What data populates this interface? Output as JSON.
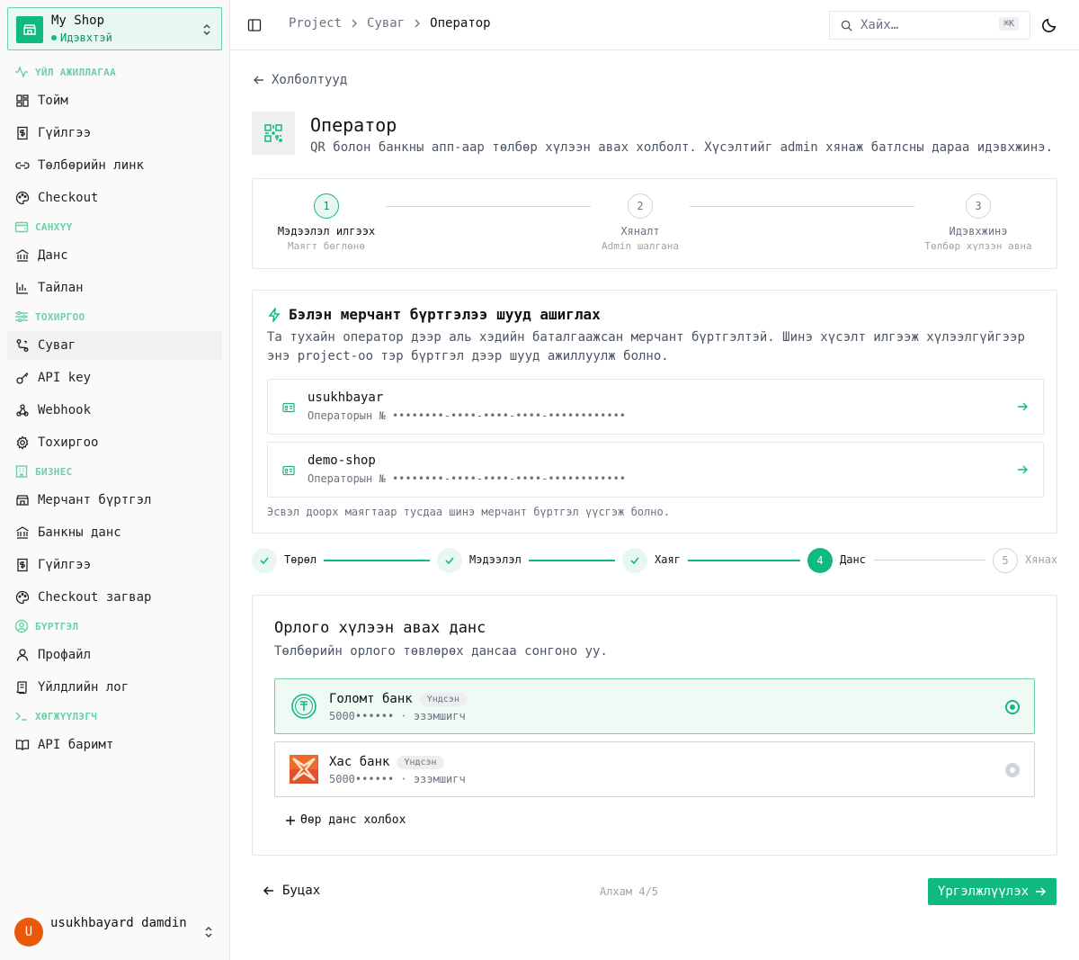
{
  "shop": {
    "name": "My Shop",
    "status": "Идэвхтэй"
  },
  "sidebar": {
    "sections": [
      {
        "label": "ҮЙЛ АЖИЛЛАГАА",
        "icon": "activity-icon"
      },
      {
        "label": "САНХҮҮ",
        "icon": "wallet-icon"
      },
      {
        "label": "ТОХИРГОО",
        "icon": "sliders-icon"
      },
      {
        "label": "БИЗНЕС",
        "icon": "building-icon"
      },
      {
        "label": "БҮРТГЭЛ",
        "icon": "user-circle-icon"
      },
      {
        "label": "ХӨГЖҮҮЛЭГЧ",
        "icon": "terminal-icon"
      }
    ],
    "items": [
      {
        "label": "Тойм",
        "icon": "dashboard-icon"
      },
      {
        "label": "Гүйлгээ",
        "icon": "receipt-icon"
      },
      {
        "label": "Төлбөрийн линк",
        "icon": "link-icon"
      },
      {
        "label": "Checkout",
        "icon": "palette-icon"
      },
      {
        "label": "Данс",
        "icon": "bank-icon"
      },
      {
        "label": "Тайлан",
        "icon": "bar-chart-icon"
      },
      {
        "label": "Суваг",
        "icon": "route-icon",
        "active": true
      },
      {
        "label": "API key",
        "icon": "key-icon"
      },
      {
        "label": "Webhook",
        "icon": "webhook-icon"
      },
      {
        "label": "Тохиргоо",
        "icon": "gear-icon"
      },
      {
        "label": "Мерчант бүртгэл",
        "icon": "store-icon"
      },
      {
        "label": "Банкны данс",
        "icon": "bank-icon"
      },
      {
        "label": "Гүйлгээ",
        "icon": "receipt-icon"
      },
      {
        "label": "Checkout загвар",
        "icon": "palette-icon"
      },
      {
        "label": "Профайл",
        "icon": "user-icon"
      },
      {
        "label": "Үйлдлийн лог",
        "icon": "log-icon"
      },
      {
        "label": "API баримт",
        "icon": "book-icon"
      }
    ]
  },
  "user": {
    "initial": "U",
    "name": "usukhbayard damdin"
  },
  "header": {
    "breadcrumb": [
      "Project",
      "Суваг",
      "Оператор"
    ],
    "search_placeholder": "Хайх…",
    "search_shortcut": "⌘K"
  },
  "page": {
    "back_label": "Холболтууд",
    "title": "Оператор",
    "description": "QR болон банкны апп-аар төлбөр хүлээн авах холболт. Хүсэлтийг admin хянаж батлсны дараа идэвхжинэ."
  },
  "process_steps": [
    {
      "num": "1",
      "label": "Мэдээлэл илгээх",
      "sub": "Маягт бөглөнө"
    },
    {
      "num": "2",
      "label": "Хяналт",
      "sub": "Admin шалгана"
    },
    {
      "num": "3",
      "label": "Идэвхжинэ",
      "sub": "Төлбөр хүлээн авна"
    }
  ],
  "existing": {
    "title": "Бэлэн мерчант бүртгэлээ шууд ашиглах",
    "description": "Та тухайн оператор дээр аль хэдийн баталгаажсан мерчант бүртгэлтэй. Шинэ хүсэлт илгээж хүлээлгүйгээр энэ project-оо тэр бүртгэл дээр шууд ажиллуулж болно.",
    "merchants": [
      {
        "name": "usukhbayar",
        "id_label": "Операторын №",
        "id": "••••••••-••••-••••-••••-••••••••••••"
      },
      {
        "name": "demo-shop",
        "id_label": "Операторын №",
        "id": "••••••••-••••-••••-••••-••••••••••••"
      }
    ],
    "footer": "Эсвэл доорх маягтаар тусдаа шинэ мерчант бүртгэл үүсгэж болно."
  },
  "wizard": {
    "steps": [
      {
        "label": "Төрөл",
        "state": "done"
      },
      {
        "label": "Мэдээлэл",
        "state": "done"
      },
      {
        "label": "Хаяг",
        "state": "done"
      },
      {
        "label": "Данс",
        "state": "current",
        "num": "4"
      },
      {
        "label": "Хянах",
        "state": "todo",
        "num": "5"
      }
    ]
  },
  "account": {
    "title": "Орлого хүлээн авах данс",
    "description": "Төлбөрийн орлого төвлөрөх дансаа сонгоно уу.",
    "banks": [
      {
        "name": "Голомт банк",
        "badge": "Үндсэн",
        "number": "5000•••••• · эзэмшигч",
        "selected": true
      },
      {
        "name": "Хас банк",
        "badge": "Үндсэн",
        "number": "5000•••••• · эзэмшигч",
        "selected": false
      }
    ],
    "add_label": "Өөр данс холбох"
  },
  "footer": {
    "back": "Буцах",
    "step": "Алхам 4/5",
    "next": "Үргэлжлүүлэх"
  },
  "colors": {
    "accent": "#10b981",
    "accent_dark": "#059669",
    "avatar": "#ea580c"
  }
}
